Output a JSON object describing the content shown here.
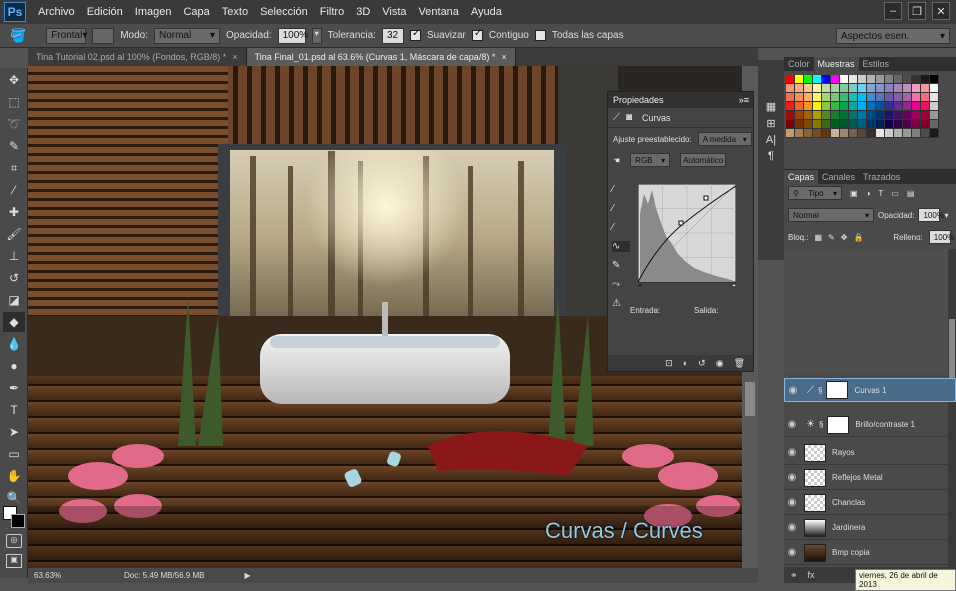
{
  "menubar": {
    "logo": "Ps",
    "items": [
      "Archivo",
      "Edición",
      "Imagen",
      "Capa",
      "Texto",
      "Selección",
      "Filtro",
      "3D",
      "Vista",
      "Ventana",
      "Ayuda"
    ]
  },
  "options": {
    "fill_source": "Frontal",
    "mode_label": "Modo:",
    "mode_value": "Normal",
    "opacity_label": "Opacidad:",
    "opacity_value": "100%",
    "tolerance_label": "Tolerancia:",
    "tolerance_value": "32",
    "antialias_label": "Suavizar",
    "contiguous_label": "Contiguo",
    "all_layers_label": "Todas las capas",
    "workspace": "Aspectos esen."
  },
  "tabs": [
    {
      "label": "Tina Tutorial 02.psd al 100% (Fondos, RGB/8) *"
    },
    {
      "label": "Tina Final_01.psd al 63.6% (Curvas 1, Máscara de capa/8) *"
    }
  ],
  "status": {
    "zoom": "63.63%",
    "doc": "Doc: 5.49 MB/56.9 MB"
  },
  "caption": "Curvas / Curves",
  "properties": {
    "title": "Propiedades",
    "type_label": "Curvas",
    "preset_label": "Ajuste preestablecido:",
    "preset_value": "A medida",
    "channel": "RGB",
    "auto_label": "Automático",
    "input_label": "Entrada:",
    "output_label": "Salida:"
  },
  "swatch_panel": {
    "tabs": [
      "Color",
      "Muestras",
      "Estilos"
    ]
  },
  "layers_panel": {
    "tabs": [
      "Capas",
      "Canales",
      "Trazados"
    ],
    "filter_label": "Tipo",
    "blend_mode": "Normal",
    "opacity_label": "Opacidad:",
    "opacity_value": "100%",
    "lock_label": "Bloq.:",
    "fill_label": "Relleno:",
    "fill_value": "100%",
    "layers": [
      {
        "name": "Curvas 1",
        "selected": true
      },
      {
        "name": "Brillo/contraste 1",
        "selected": false
      },
      {
        "name": "Rayos",
        "selected": false
      },
      {
        "name": "Reflejos Metal",
        "selected": false
      },
      {
        "name": "Chanclas",
        "selected": false
      },
      {
        "name": "Jardinera",
        "selected": false
      },
      {
        "name": "Bmp copia",
        "selected": false
      }
    ]
  },
  "tooltip": "viernes, 26 de abril de 2013",
  "colors": {
    "selection": "#4b6b8a",
    "ps_blue": "#5fb4ff",
    "caption": "#8ec9ea"
  }
}
